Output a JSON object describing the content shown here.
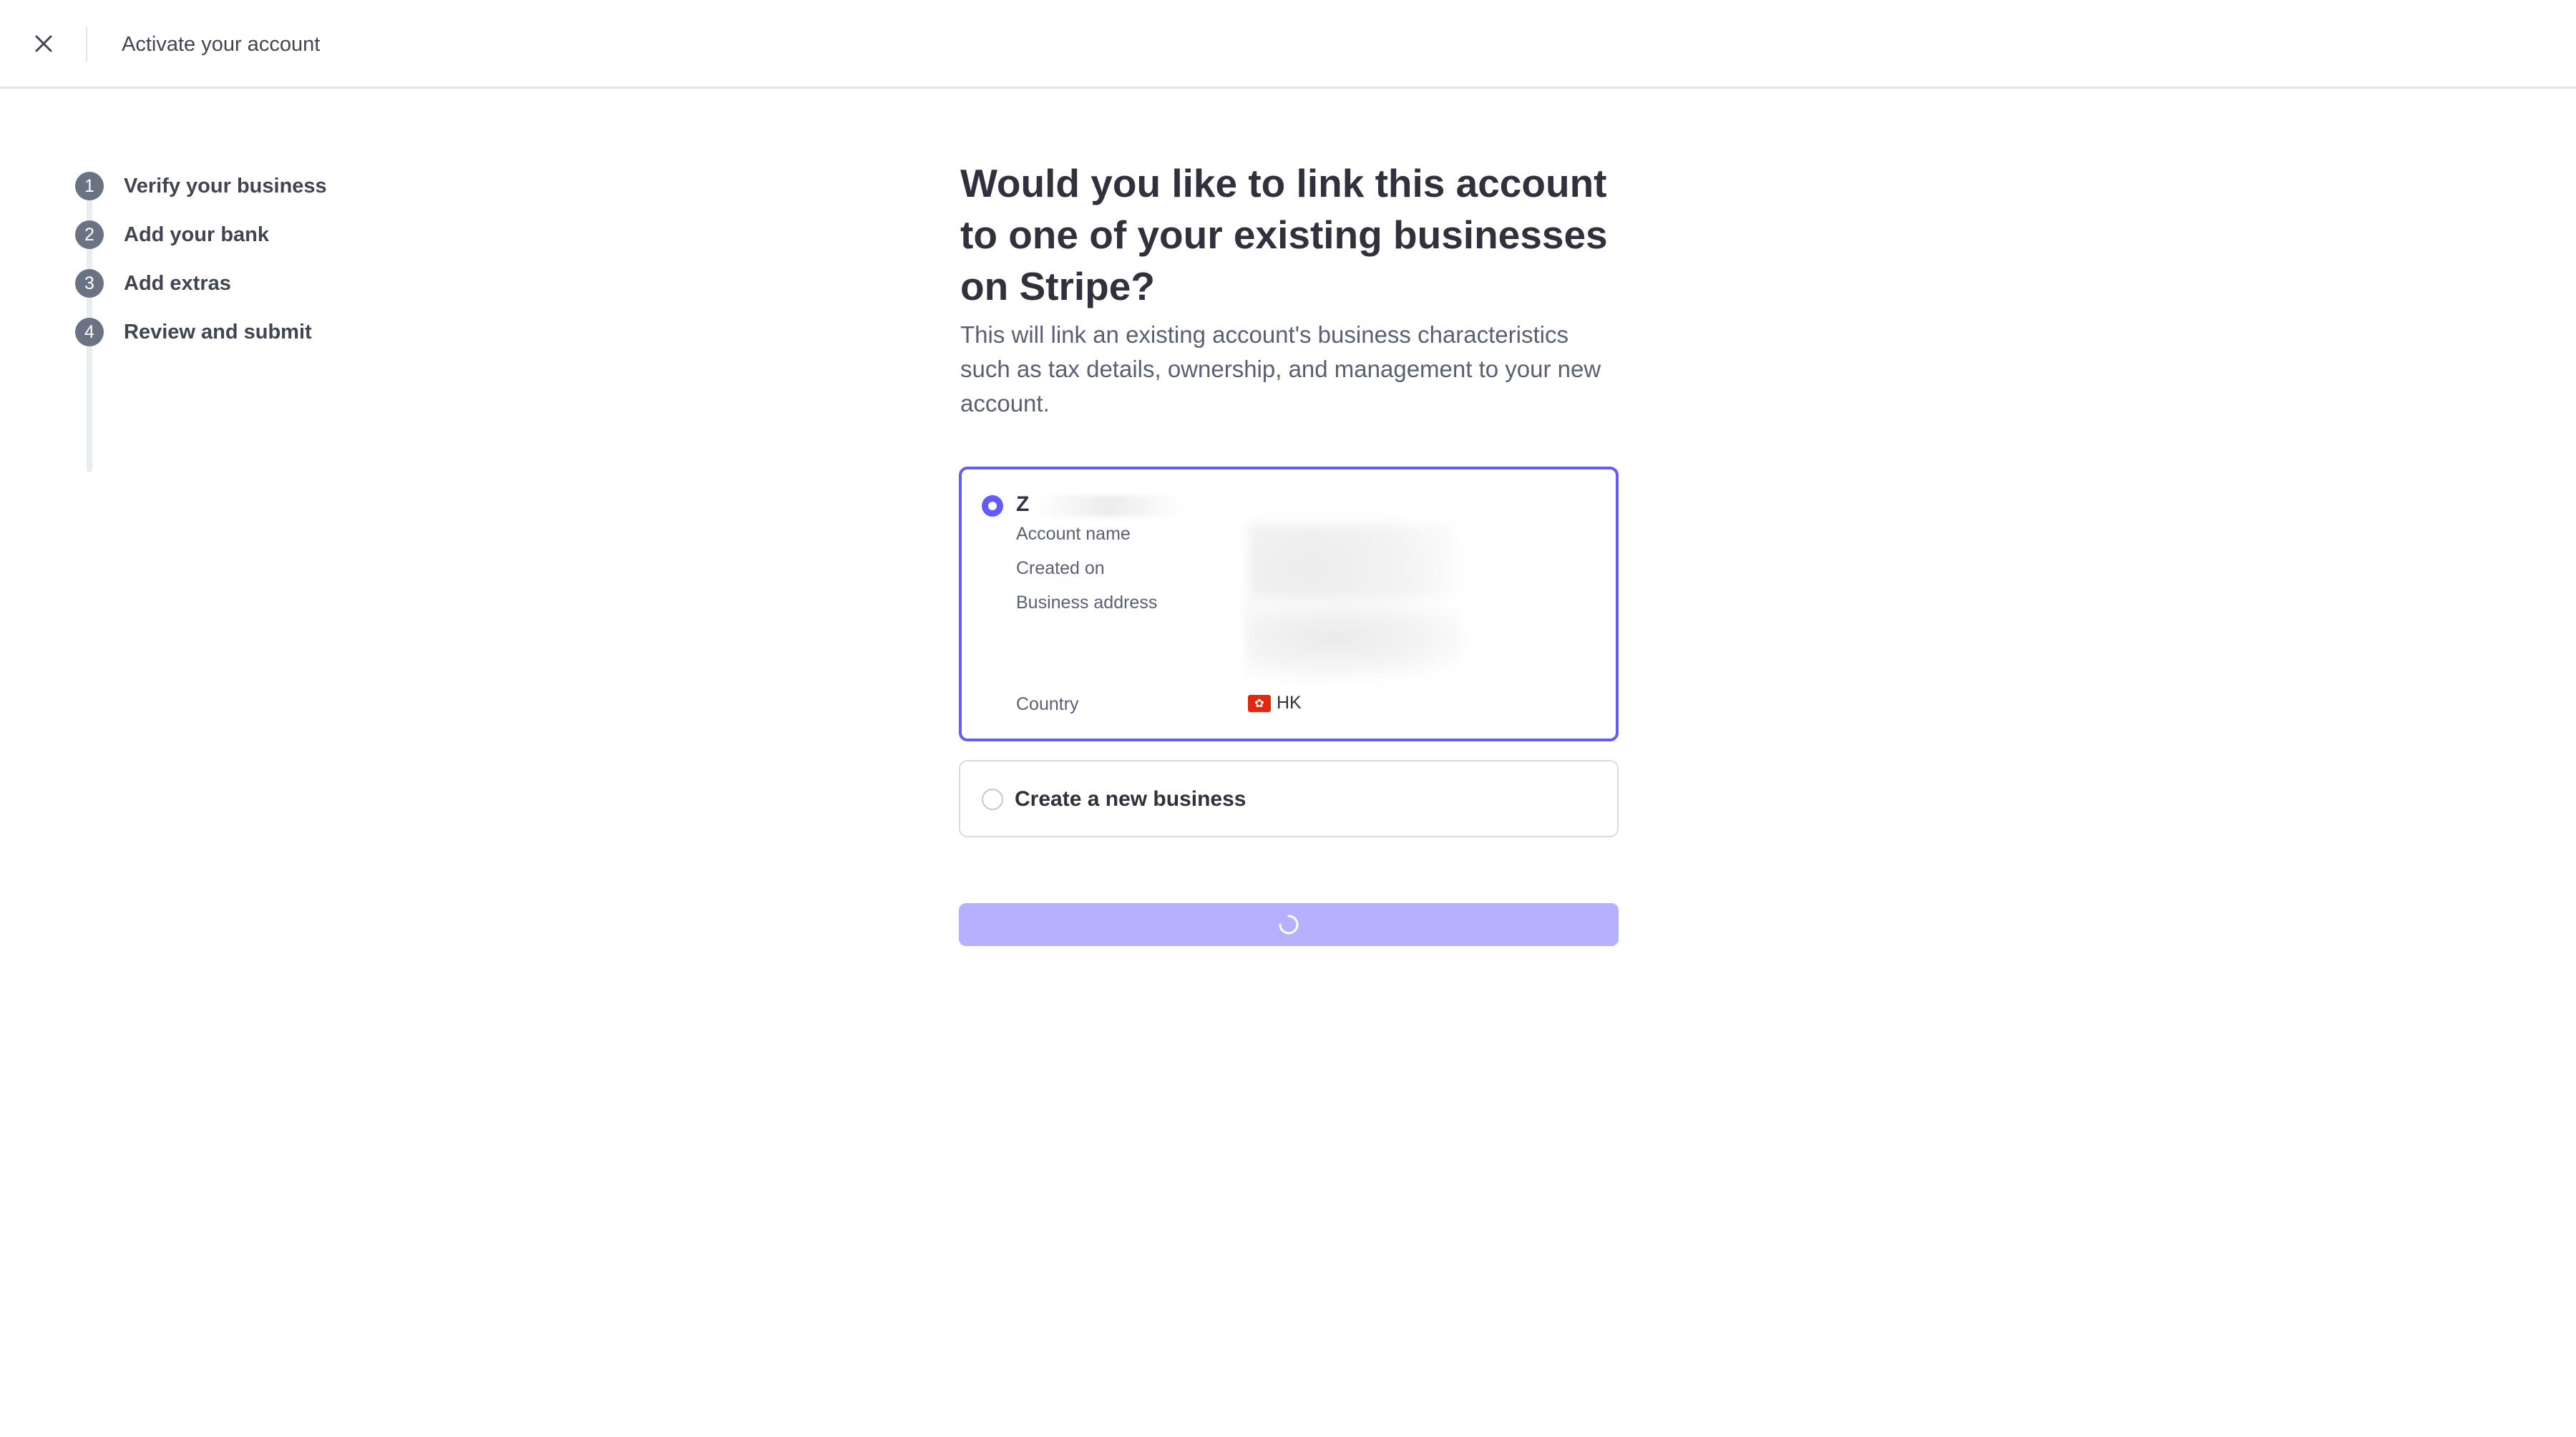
{
  "topbar": {
    "close_icon": "close-icon",
    "title": "Activate your account"
  },
  "stepper": {
    "steps": [
      {
        "number": "1",
        "label": "Verify your business"
      },
      {
        "number": "2",
        "label": "Add your bank"
      },
      {
        "number": "3",
        "label": "Add extras"
      },
      {
        "number": "4",
        "label": "Review and submit"
      }
    ]
  },
  "main": {
    "heading": "Would you like to link this account to one of your existing businesses on Stripe?",
    "description": "This will link an existing account's business characteristics such as tax details, ownership, and management to your new account.",
    "options": {
      "existing": {
        "name": "Z",
        "selected": true,
        "fields": {
          "account_name_label": "Account name",
          "created_on_label": "Created on",
          "business_address_label": "Business address",
          "country_label": "Country",
          "country_value": "HK",
          "country_flag_icon": "hong-kong-flag-icon"
        }
      },
      "new_business": {
        "label": "Create a new business",
        "selected": false
      }
    },
    "submit": {
      "state": "loading",
      "icon": "loading-spinner-icon"
    }
  },
  "colors": {
    "accent": "#635bff",
    "button_disabled": "#b5b0ff",
    "step_circle": "#6a7383",
    "text_primary": "#30313d",
    "text_secondary": "#596171",
    "border": "#d5dbe1"
  }
}
